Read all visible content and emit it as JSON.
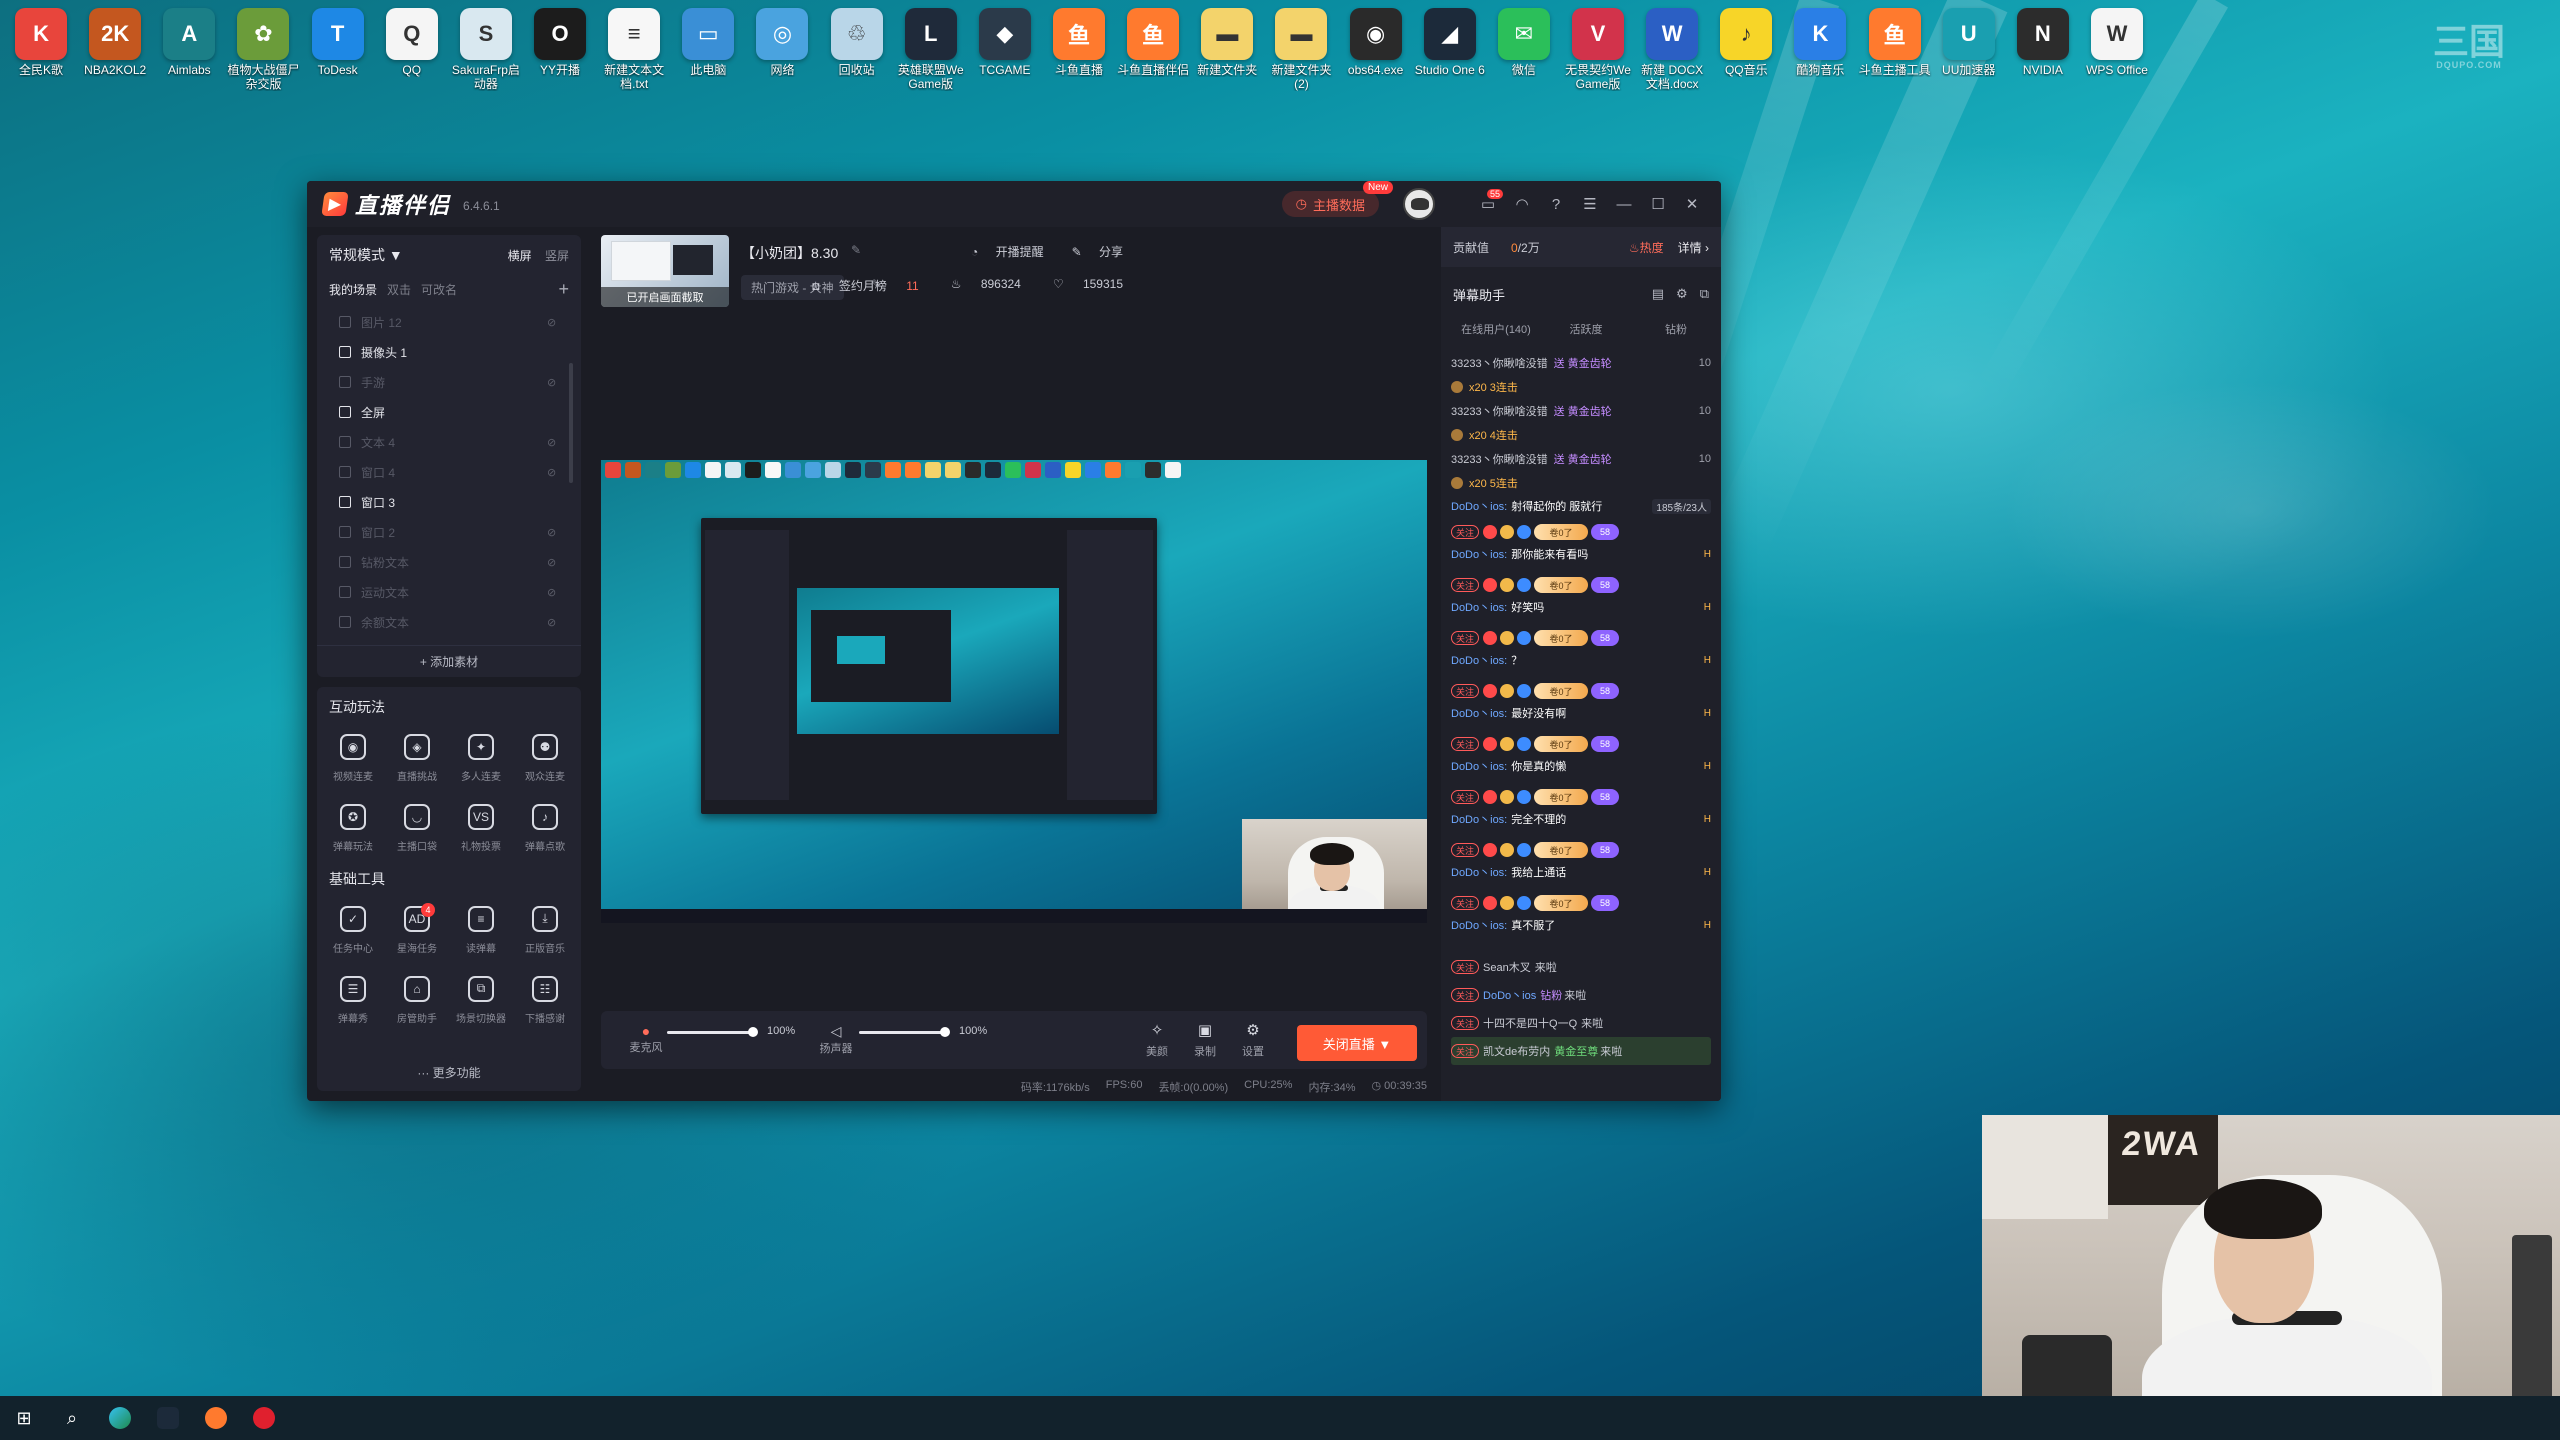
{
  "desktop": {
    "icons": [
      {
        "label": "全民K歌",
        "color": "#e8453c",
        "glyph": "K"
      },
      {
        "label": "NBA2KOL2",
        "color": "#c4571f",
        "glyph": "2K"
      },
      {
        "label": "Aimlabs",
        "color": "#1b7f87",
        "glyph": "A"
      },
      {
        "label": "植物大战僵尸杂交版",
        "color": "#6b9c3a",
        "glyph": "✿"
      },
      {
        "label": "ToDesk",
        "color": "#1e88e5",
        "glyph": "T"
      },
      {
        "label": "QQ",
        "color": "#f5f5f5",
        "glyph": "Q"
      },
      {
        "label": "SakuraFrp启动器",
        "color": "#d9e8f0",
        "glyph": "S"
      },
      {
        "label": "YY开播",
        "color": "#1c1c1c",
        "glyph": "O"
      },
      {
        "label": "新建文本文档.txt",
        "color": "#f7f7f7",
        "glyph": "≡"
      },
      {
        "label": "此电脑",
        "color": "#3a8fd6",
        "glyph": "▭"
      },
      {
        "label": "网络",
        "color": "#4aa3df",
        "glyph": "◎"
      },
      {
        "label": "回收站",
        "color": "#b9d6e8",
        "glyph": "♲"
      },
      {
        "label": "英雄联盟WeGame版",
        "color": "#1f2a3a",
        "glyph": "L"
      },
      {
        "label": "TCGAME",
        "color": "#2b3a4a",
        "glyph": "◆"
      },
      {
        "label": "斗鱼直播",
        "color": "#ff7a2e",
        "glyph": "鱼"
      },
      {
        "label": "斗鱼直播伴侣",
        "color": "#ff7a2e",
        "glyph": "鱼"
      },
      {
        "label": "新建文件夹",
        "color": "#f3d36b",
        "glyph": "▬"
      },
      {
        "label": "新建文件夹(2)",
        "color": "#f3d36b",
        "glyph": "▬"
      },
      {
        "label": "obs64.exe",
        "color": "#2a2a2a",
        "glyph": "◉"
      },
      {
        "label": "Studio One 6",
        "color": "#1c2a3a",
        "glyph": "◢"
      },
      {
        "label": "微信",
        "color": "#2bbf5a",
        "glyph": "✉"
      },
      {
        "label": "无畏契约WeGame版",
        "color": "#d2334b",
        "glyph": "V"
      },
      {
        "label": "新建 DOCX 文档.docx",
        "color": "#2b5fc4",
        "glyph": "W"
      },
      {
        "label": "QQ音乐",
        "color": "#f7d528",
        "glyph": "♪"
      },
      {
        "label": "酷狗音乐",
        "color": "#2a7fe6",
        "glyph": "K"
      },
      {
        "label": "斗鱼主播工具",
        "color": "#ff7a2e",
        "glyph": "鱼"
      },
      {
        "label": "UU加速器",
        "color": "#1a9fb0",
        "glyph": "U"
      },
      {
        "label": "NVIDIA",
        "color": "#2c2c2c",
        "glyph": "N"
      },
      {
        "label": "WPS Office",
        "color": "#f5f5f5",
        "glyph": "W"
      }
    ],
    "watermark": "三国",
    "watermark_sub": "DQUPO.COM"
  },
  "app": {
    "logo_text": "直播伴侣",
    "version": "6.4.6.1",
    "anchor_data_btn": "主播数据",
    "new_badge": "New",
    "msg_badge": "55",
    "left": {
      "mode": "常规模式 ▼",
      "mode_tabs": [
        "横屏",
        "竖屏"
      ],
      "scene_tabs": [
        "我的场景",
        "双击",
        "可改名"
      ],
      "add": "+",
      "scenes": [
        {
          "label": "图片 12",
          "visible": false
        },
        {
          "label": "摄像头 1",
          "visible": true
        },
        {
          "label": "手游",
          "visible": false
        },
        {
          "label": "全屏",
          "visible": true
        },
        {
          "label": "文本 4",
          "visible": false
        },
        {
          "label": "窗口 4",
          "visible": false
        },
        {
          "label": "窗口 3",
          "visible": true
        },
        {
          "label": "窗口 2",
          "visible": false
        },
        {
          "label": "钻粉文本",
          "visible": false
        },
        {
          "label": "运动文本",
          "visible": false
        },
        {
          "label": "余额文本",
          "visible": false
        }
      ],
      "add_material": "+ 添加素材",
      "interactive_title": "互动玩法",
      "interactive": [
        {
          "label": "视频连麦",
          "glyph": "◉"
        },
        {
          "label": "直播挑战",
          "glyph": "◈"
        },
        {
          "label": "多人连麦",
          "glyph": "✦"
        },
        {
          "label": "观众连麦",
          "glyph": "⚉"
        },
        {
          "label": "弹幕玩法",
          "glyph": "✪"
        },
        {
          "label": "主播口袋",
          "glyph": "◡"
        },
        {
          "label": "礼物投票",
          "glyph": "VS"
        },
        {
          "label": "弹幕点歌",
          "glyph": "♪"
        }
      ],
      "basic_title": "基础工具",
      "basic": [
        {
          "label": "任务中心",
          "glyph": "✓",
          "badge": ""
        },
        {
          "label": "星海任务",
          "glyph": "AD",
          "badge": "4"
        },
        {
          "label": "读弹幕",
          "glyph": "≡",
          "badge": ""
        },
        {
          "label": "正版音乐",
          "glyph": "⤓",
          "badge": ""
        },
        {
          "label": "弹幕秀",
          "glyph": "☰",
          "badge": ""
        },
        {
          "label": "房管助手",
          "glyph": "⌂",
          "badge": ""
        },
        {
          "label": "场景切换器",
          "glyph": "⧉",
          "badge": ""
        },
        {
          "label": "下播感谢",
          "glyph": "☷",
          "badge": ""
        }
      ],
      "more": "··· 更多功能"
    },
    "center": {
      "thumb_label": "已开启画面截取",
      "room_title": "【小奶团】8.30",
      "category": "热门游戏 - 大神",
      "remind": "开播提醒",
      "share": "分享",
      "checkin": "签约月榜",
      "checkin_num": "11",
      "hot": "896324",
      "likes": "159315",
      "mic_label": "麦克风",
      "mic_pct": "100%",
      "mic_level": 0.95,
      "spk_label": "扬声器",
      "spk_pct": "100%",
      "spk_level": 0.95,
      "beauty": "美颜",
      "record": "录制",
      "settings": "设置",
      "live_btn": "关闭直播 ▼",
      "status": [
        "码率:1176kb/s",
        "FPS:60",
        "丢帧:0(0.00%)",
        "CPU:25%",
        "内存:34%",
        "◷ 00:39:35"
      ]
    },
    "right": {
      "contrib_label": "贡献值",
      "contrib_value": "0",
      "contrib_target": "/2万",
      "hot_label": "热度",
      "detail": "详情 ›",
      "danmu_title": "弹幕助手",
      "tabs": [
        "在线用户(140)",
        "活跃度",
        "钻粉"
      ],
      "gifts": [
        {
          "user": "33233丶你瞅啥没错",
          "gift": "送 黄金齿轮",
          "num": "10",
          "combo": "x20 3连击"
        },
        {
          "user": "33233丶你瞅啥没错",
          "gift": "送 黄金齿轮",
          "num": "10",
          "combo": "x20 4连击"
        },
        {
          "user": "33233丶你瞅啥没错",
          "gift": "送 黄金齿轮",
          "num": "10",
          "combo": "x20 5连击"
        }
      ],
      "first_msg": {
        "user": "DoDo丶ios:",
        "text": "射得起你的 服就行",
        "count": "185条/23人"
      },
      "messages": [
        {
          "user": "DoDo丶ios:",
          "text": "那你能来有看吗",
          "fan": "卷0了",
          "lvl": "58"
        },
        {
          "user": "DoDo丶ios:",
          "text": "好笑吗",
          "fan": "卷0了",
          "lvl": "58"
        },
        {
          "user": "DoDo丶ios:",
          "text": "？",
          "fan": "卷0了",
          "lvl": "58"
        },
        {
          "user": "DoDo丶ios:",
          "text": "最好没有啊",
          "fan": "卷0了",
          "lvl": "58"
        },
        {
          "user": "DoDo丶ios:",
          "text": "你是真的懒",
          "fan": "卷0了",
          "lvl": "58"
        },
        {
          "user": "DoDo丶ios:",
          "text": "完全不理的",
          "fan": "卷0了",
          "lvl": "58"
        },
        {
          "user": "DoDo丶ios:",
          "text": "我给上通话",
          "fan": "卷0了",
          "lvl": "58"
        },
        {
          "user": "DoDo丶ios:",
          "text": "真不服了",
          "fan": "卷0了",
          "lvl": "58"
        }
      ],
      "follow": "关注",
      "h_mark": "H",
      "enters": [
        {
          "user": "Sean木叉",
          "lvl": "",
          "text": "来啦",
          "blue": false,
          "hl": false
        },
        {
          "user": "DoDo丶ios",
          "lvl": "钻粉",
          "text": "来啦",
          "blue": true,
          "hl": false
        },
        {
          "user": "十四不是四十Q一Q",
          "lvl": "",
          "text": "来啦",
          "blue": false,
          "hl": false
        },
        {
          "user": "凯文de布劳内",
          "lvl": "黄金至尊",
          "text": "来啦",
          "blue": false,
          "hl": true
        }
      ]
    }
  },
  "webcam": {
    "poster_text": "2WA"
  },
  "colors": {
    "accent": "#ff5a36",
    "panel": "#232430",
    "window": "#1b1c24"
  }
}
